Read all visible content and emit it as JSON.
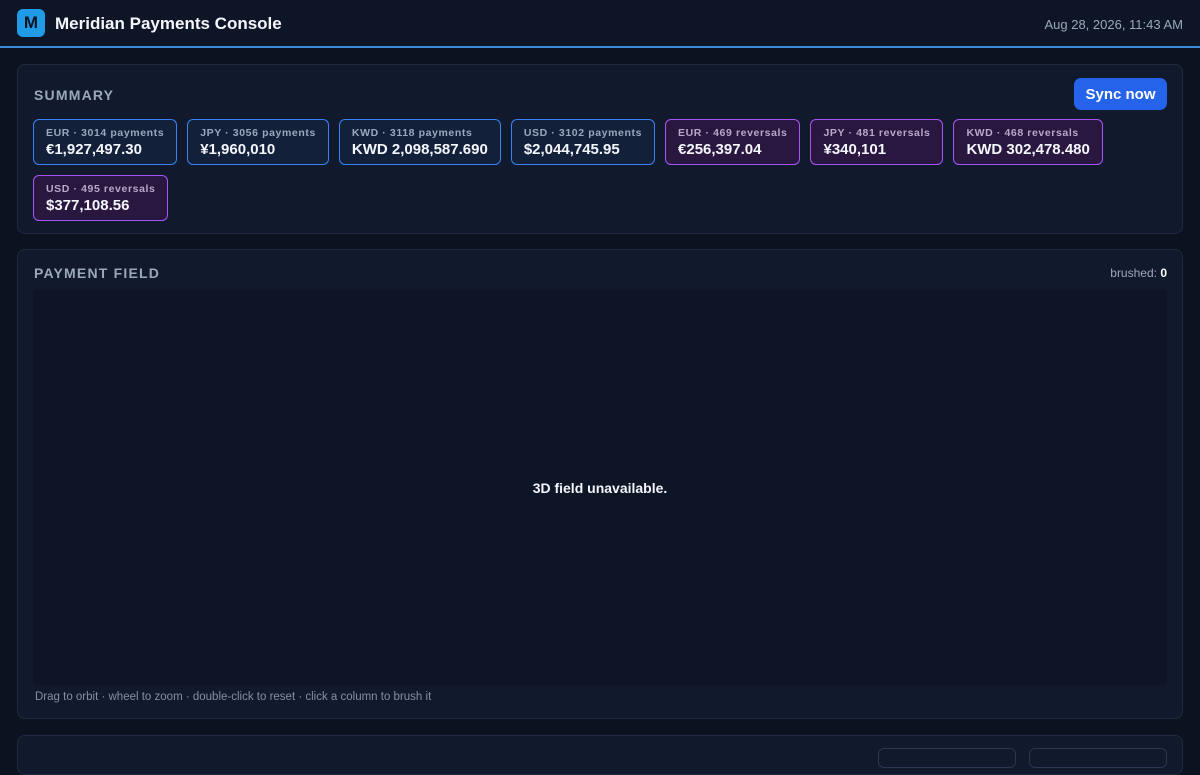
{
  "header": {
    "logo_letter": "M",
    "title": "Meridian Payments Console",
    "timestamp": "Aug 28, 2026, 11:43 AM"
  },
  "summary": {
    "title": "SUMMARY",
    "sync_label": "Sync now",
    "tiles": [
      {
        "label": "EUR · 3014 payments",
        "value": "€1,927,497.30",
        "kind": "payment"
      },
      {
        "label": "JPY · 3056 payments",
        "value": "¥1,960,010",
        "kind": "payment"
      },
      {
        "label": "KWD · 3118 payments",
        "value": "KWD 2,098,587.690",
        "kind": "payment"
      },
      {
        "label": "USD · 3102 payments",
        "value": "$2,044,745.95",
        "kind": "payment"
      },
      {
        "label": "EUR · 469 reversals",
        "value": "€256,397.04",
        "kind": "reversal"
      },
      {
        "label": "JPY · 481 reversals",
        "value": "¥340,101",
        "kind": "reversal"
      },
      {
        "label": "KWD · 468 reversals",
        "value": "KWD 302,478.480",
        "kind": "reversal"
      },
      {
        "label": "USD · 495 reversals",
        "value": "$377,108.56",
        "kind": "reversal"
      }
    ]
  },
  "field": {
    "title": "PAYMENT FIELD",
    "brushed_label": "brushed:",
    "brushed_count": "0",
    "unavailable_message": "3D field unavailable.",
    "hint": "Drag to orbit · wheel to zoom · double-click to reset · click a column to brush it"
  },
  "colors": {
    "accent": "#2563eb",
    "payment_border": "#3b82f6",
    "reversal_border": "#a855f7",
    "header_rule": "#3b8fd9"
  }
}
